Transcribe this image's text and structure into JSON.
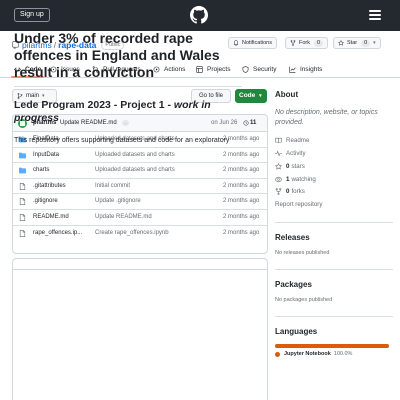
{
  "topbar": {
    "signup": "Sign up"
  },
  "repo": {
    "owner": "pilartms",
    "slash": "/",
    "name": "rape-data",
    "visibility": "Public",
    "notifications": "Notifications",
    "fork_label": "Fork",
    "fork_count": "0",
    "star_label": "Star",
    "star_count": "0"
  },
  "tabs": [
    {
      "label": "Code"
    },
    {
      "label": "Issues"
    },
    {
      "label": "Pull requests"
    },
    {
      "label": "Actions"
    },
    {
      "label": "Projects"
    },
    {
      "label": "Security"
    },
    {
      "label": "Insights"
    }
  ],
  "branch": {
    "name": "main",
    "goto_file": "Go to file",
    "code": "Code"
  },
  "commit": {
    "user": "pilartms",
    "message": "Update README.md",
    "dots": "...",
    "date": "on Jun 26",
    "history": "11"
  },
  "files": [
    {
      "name": "FinalData",
      "msg": "Uploaded datasets and charts",
      "date": "2 months ago"
    },
    {
      "name": "InputData",
      "msg": "Uploaded datasets and charts",
      "date": "2 months ago"
    },
    {
      "name": "charts",
      "msg": "Uploaded datasets and charts",
      "date": "2 months ago"
    },
    {
      "name": ".gitattributes",
      "msg": "Initial commit",
      "date": "2 months ago"
    },
    {
      "name": ".gitignore",
      "msg": "Update .gitignore",
      "date": "2 months ago"
    },
    {
      "name": "README.md",
      "msg": "Update README.md",
      "date": "2 months ago"
    },
    {
      "name": "rape_offences.ip...",
      "msg": "Create rape_offences.ipynb",
      "date": "2 months ago"
    }
  ],
  "readme": {
    "h1": "Under 3% of recorded rape offences in England and Wales result in a conviction",
    "h2_plain": "Lede Program 2023 - Project 1 - ",
    "h2_em": "work in progress",
    "p": "This repository offers supporting datasets and code for an exploratory"
  },
  "about": {
    "title": "About",
    "desc": "No description, website, or topics provided.",
    "readme": "Readme",
    "activity": "Activity",
    "stars_n": "0",
    "stars_l": "stars",
    "watching_n": "1",
    "watching_l": "watching",
    "forks_n": "0",
    "forks_l": "forks",
    "report": "Report repository"
  },
  "releases": {
    "title": "Releases",
    "none": "No releases published"
  },
  "packages": {
    "title": "Packages",
    "none": "No packages published"
  },
  "languages": {
    "title": "Languages",
    "name": "Jupyter Notebook",
    "pct": "100.0%",
    "percent": 100,
    "color": "#DA5B0B"
  }
}
